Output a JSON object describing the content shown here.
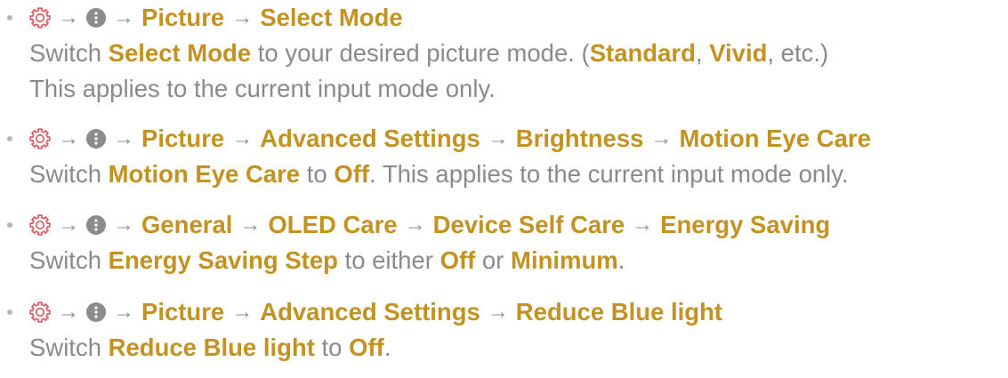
{
  "accent_color": "#c39221",
  "text_color": "#8a8a8a",
  "arrow_glyph": "→",
  "icons": [
    "gear-icon",
    "more-menu-icon"
  ],
  "items": [
    {
      "path": [
        "Picture",
        "Select Mode"
      ],
      "desc": [
        {
          "t": "Switch "
        },
        {
          "t": "Select Mode",
          "b": true
        },
        {
          "t": " to your desired picture mode. ("
        },
        {
          "t": "Standard",
          "b": true
        },
        {
          "t": ", "
        },
        {
          "t": "Vivid",
          "b": true
        },
        {
          "t": ", etc.)"
        }
      ],
      "desc2": "This applies to the current input mode only."
    },
    {
      "path": [
        "Picture",
        "Advanced Settings",
        "Brightness",
        "Motion Eye Care"
      ],
      "desc": [
        {
          "t": "Switch "
        },
        {
          "t": "Motion Eye Care",
          "b": true
        },
        {
          "t": " to "
        },
        {
          "t": "Off",
          "b": true
        },
        {
          "t": ". This applies to the current input mode only."
        }
      ]
    },
    {
      "path": [
        "General",
        "OLED Care",
        "Device Self Care",
        "Energy Saving"
      ],
      "desc": [
        {
          "t": "Switch "
        },
        {
          "t": "Energy Saving Step",
          "b": true
        },
        {
          "t": " to either "
        },
        {
          "t": "Off",
          "b": true
        },
        {
          "t": " or "
        },
        {
          "t": "Minimum",
          "b": true
        },
        {
          "t": "."
        }
      ]
    },
    {
      "path": [
        "Picture",
        "Advanced Settings",
        "Reduce Blue light"
      ],
      "desc": [
        {
          "t": "Switch "
        },
        {
          "t": "Reduce Blue light",
          "b": true
        },
        {
          "t": " to "
        },
        {
          "t": "Off",
          "b": true
        },
        {
          "t": "."
        }
      ]
    }
  ]
}
